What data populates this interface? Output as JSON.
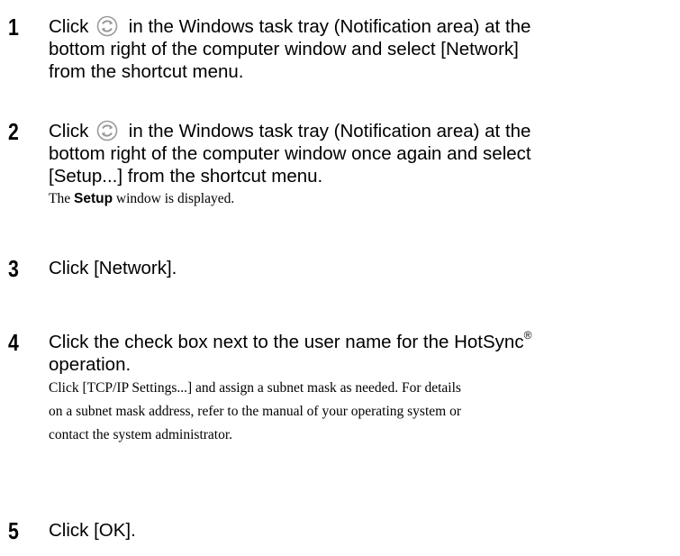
{
  "steps": [
    {
      "number": "1",
      "lines": [
        [
          "Click ",
          "sync-icon",
          " in the Windows task tray (Notification area) at the"
        ],
        [
          "bottom right of the computer window and select [Network]"
        ],
        [
          "from the shortcut menu."
        ]
      ]
    },
    {
      "number": "2",
      "lines": [
        [
          "Click ",
          "sync-icon",
          " in the Windows task tray (Notification area) at the"
        ],
        [
          "bottom right of the computer window once again and select"
        ],
        [
          "[Setup...] from the shortcut menu."
        ]
      ],
      "note": {
        "pre": "The ",
        "bold": "Setup",
        "post": " window is displayed."
      }
    },
    {
      "number": "3",
      "lines": [
        [
          "Click [Network]."
        ]
      ]
    },
    {
      "number": "4",
      "lines": [
        [
          "Click the check box next to the user name for the HotSync",
          "®"
        ],
        [
          "operation."
        ]
      ],
      "detail": [
        "Click [TCP/IP Settings...] and assign a subnet mask as needed. For details",
        "on a subnet mask address, refer to the manual of your operating system or",
        "contact the system administrator."
      ]
    },
    {
      "number": "5",
      "lines": [
        [
          "Click [OK]."
        ]
      ]
    }
  ],
  "icons": {
    "sync": "hotsync-icon"
  }
}
